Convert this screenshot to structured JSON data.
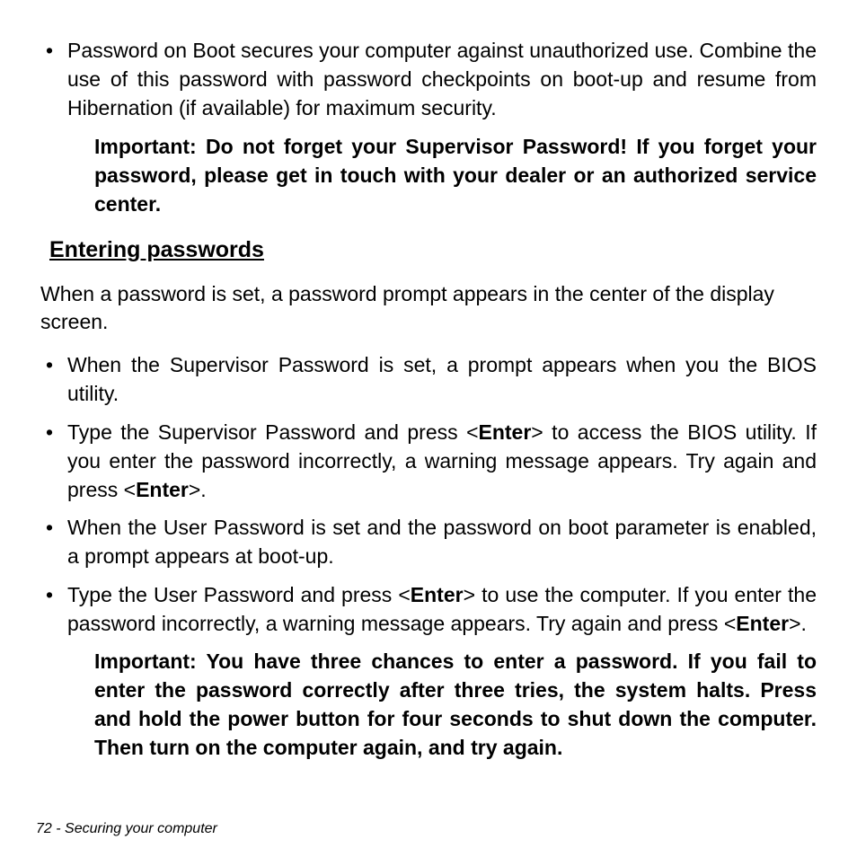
{
  "topList": {
    "item1": "Password on Boot secures your computer against unauthorized use. Combine the use of this password with password checkpoints on boot-up and resume from Hibernation (if available) for maximum security."
  },
  "callout1": "Important: Do not forget your Supervisor Password! If you forget your password, please get in touch with your dealer or an authorized service center.",
  "heading": "Entering passwords",
  "intro": "When a password is set, a password prompt appears in the center of the display screen.",
  "list2": {
    "item1": "When the Supervisor Password is set, a prompt appears when you the BIOS utility.",
    "item2_a": "Type the Supervisor Password and press <",
    "item2_key1": "Enter",
    "item2_b": "> to access the BIOS utility. If you enter the password incorrectly, a warning message appears. Try again and press <",
    "item2_key2": "Enter",
    "item2_c": ">.",
    "item3": "When the User Password is set and the password on boot parameter is enabled, a prompt appears at boot-up.",
    "item4_a": "Type the User Password and press <",
    "item4_key1": "Enter",
    "item4_b": "> to use the computer. If you enter the password incorrectly, a warning message appears. Try again and press <",
    "item4_key2": "Enter",
    "item4_c": ">."
  },
  "callout2": "Important: You have three chances to enter a password. If you fail to enter the password correctly after three tries, the system halts. Press and hold the power button for four seconds to shut down the computer. Then turn on the computer again, and try again.",
  "footer": "72 - Securing your computer"
}
